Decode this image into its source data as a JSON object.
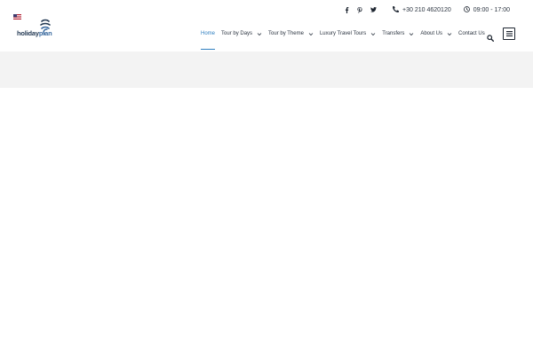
{
  "header": {
    "language_flag": "us-flag-icon",
    "logo": {
      "text_main": "holiday",
      "text_accent": "plan"
    },
    "social": [
      "facebook-icon",
      "pinterest-icon",
      "twitter-icon"
    ],
    "phone": "+30 210 4620120",
    "hours": "09:00 - 17:00"
  },
  "nav": {
    "items": [
      {
        "label": "Home",
        "active": true,
        "dropdown": false
      },
      {
        "label": "Tour by Days",
        "active": false,
        "dropdown": true
      },
      {
        "label": "Tour by Theme",
        "active": false,
        "dropdown": true
      },
      {
        "label": "Luxury Travel Tours",
        "active": false,
        "dropdown": true
      },
      {
        "label": "Transfers",
        "active": false,
        "dropdown": true
      },
      {
        "label": "About Us",
        "active": false,
        "dropdown": true
      },
      {
        "label": "Contact Us",
        "active": false,
        "dropdown": false
      }
    ]
  },
  "colors": {
    "accent": "#2f7fc0",
    "text": "#2b3440",
    "banner_bg": "#f3f3f3",
    "logo_dark": "#243a54"
  }
}
